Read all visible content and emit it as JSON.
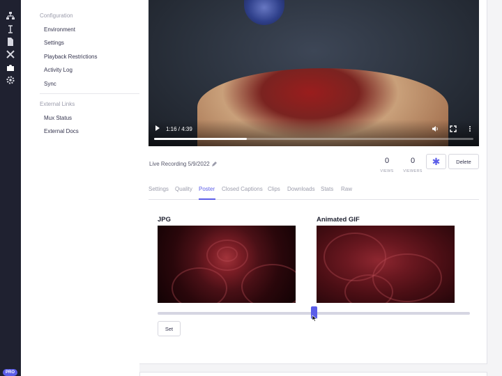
{
  "sidebar": {
    "configuration_heading": "Configuration",
    "configuration_items": [
      "Environment",
      "Settings",
      "Playback Restrictions",
      "Activity Log",
      "Sync"
    ],
    "external_heading": "External Links",
    "external_items": [
      "Mux Status",
      "External Docs"
    ]
  },
  "rail": {
    "icons": [
      "sitemap-icon",
      "cursor-text-icon",
      "document-icon",
      "tools-icon",
      "puzzle-icon",
      "gear-icon"
    ],
    "badge": "PRO"
  },
  "video": {
    "time": "1:16 / 4:39",
    "progress": 0.29
  },
  "asset": {
    "title": "Live Recording 5/9/2022",
    "views_count": "0",
    "views_label": "VIEWS",
    "viewers_count": "0",
    "viewers_label": "VIEWERS",
    "delete_label": "Delete",
    "star_glyph": "✱"
  },
  "tabs": [
    "Settings",
    "Quality",
    "Poster",
    "Closed Captions",
    "Clips",
    "Downloads",
    "Stats",
    "Raw"
  ],
  "active_tab": "Poster",
  "poster": {
    "jpg_label": "JPG",
    "gif_label": "Animated GIF",
    "slider_value": 0.5,
    "set_label": "Set"
  },
  "colors": {
    "accent": "#5b5de8",
    "rail": "#1f2130"
  }
}
